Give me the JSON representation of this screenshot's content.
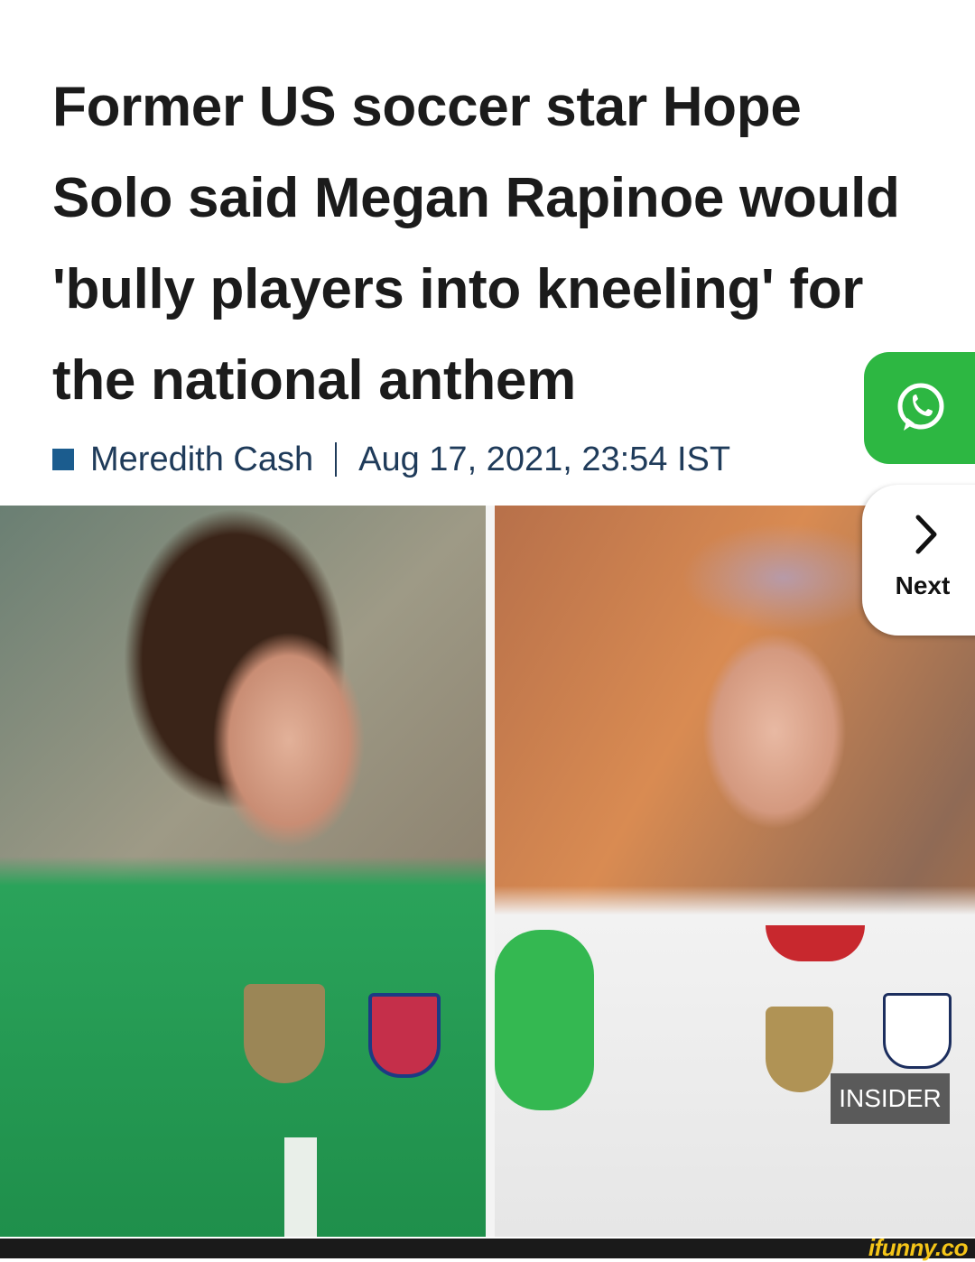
{
  "article": {
    "headline": "Former US soccer star Hope Solo said Megan Rapinoe would 'bully players into kneeling' for the national anthem",
    "author": "Meredith Cash",
    "date": "Aug 17, 2021, 23:54 IST"
  },
  "share": {
    "icon": "whatsapp-icon",
    "color": "#2db742"
  },
  "image": {
    "badge": "INSIDER"
  },
  "nav": {
    "next_label": "Next",
    "icon": "chevron-right-icon"
  },
  "watermark": "ifunny.co"
}
